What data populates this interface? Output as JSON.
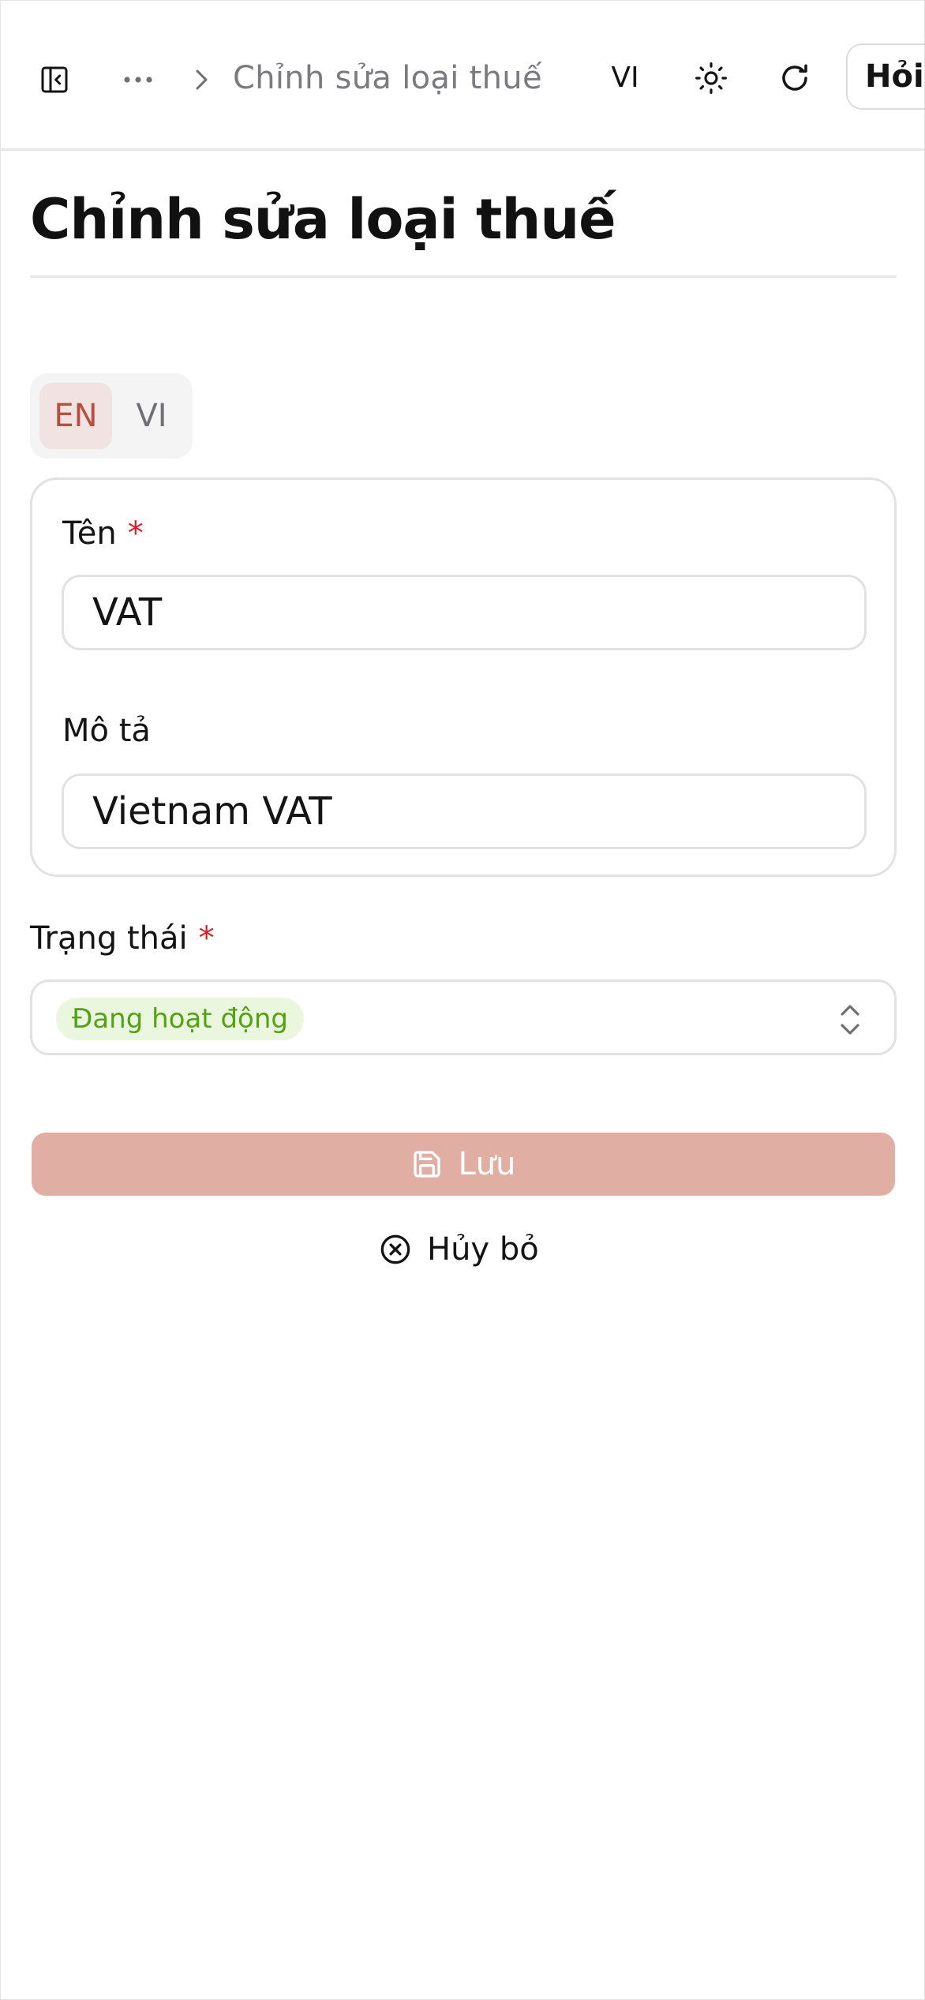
{
  "header": {
    "breadcrumb_current": "Chỉnh sửa loại thuế",
    "language_code": "VI",
    "ask_label": "Hỏi"
  },
  "page": {
    "title": "Chỉnh sửa loại thuế"
  },
  "language_tabs": {
    "items": [
      "EN",
      "VI"
    ],
    "active": "EN"
  },
  "form": {
    "name_label": "Tên",
    "name_required_mark": "*",
    "name_value": "VAT",
    "description_label": "Mô tả",
    "description_value": "Vietnam VAT",
    "status_label": "Trạng thái",
    "status_required_mark": "*",
    "status_value": "Đang hoạt động"
  },
  "actions": {
    "save_label": "Lưu",
    "cancel_label": "Hủy bỏ"
  },
  "colors": {
    "accent": "#b5503f",
    "save_button_bg": "#e0aea2",
    "required": "#d91f26",
    "status_active_text": "#52a313",
    "status_active_bg": "#ebf6df"
  },
  "icons": {
    "sidebar_toggle": "sidebar-collapse-icon",
    "more": "ellipsis-icon",
    "breadcrumb_separator": "chevron-right-icon",
    "theme": "sun-icon",
    "refresh": "refresh-icon",
    "select": "chevron-up-down-icon",
    "save": "floppy-disk-icon",
    "cancel": "circle-x-icon"
  }
}
